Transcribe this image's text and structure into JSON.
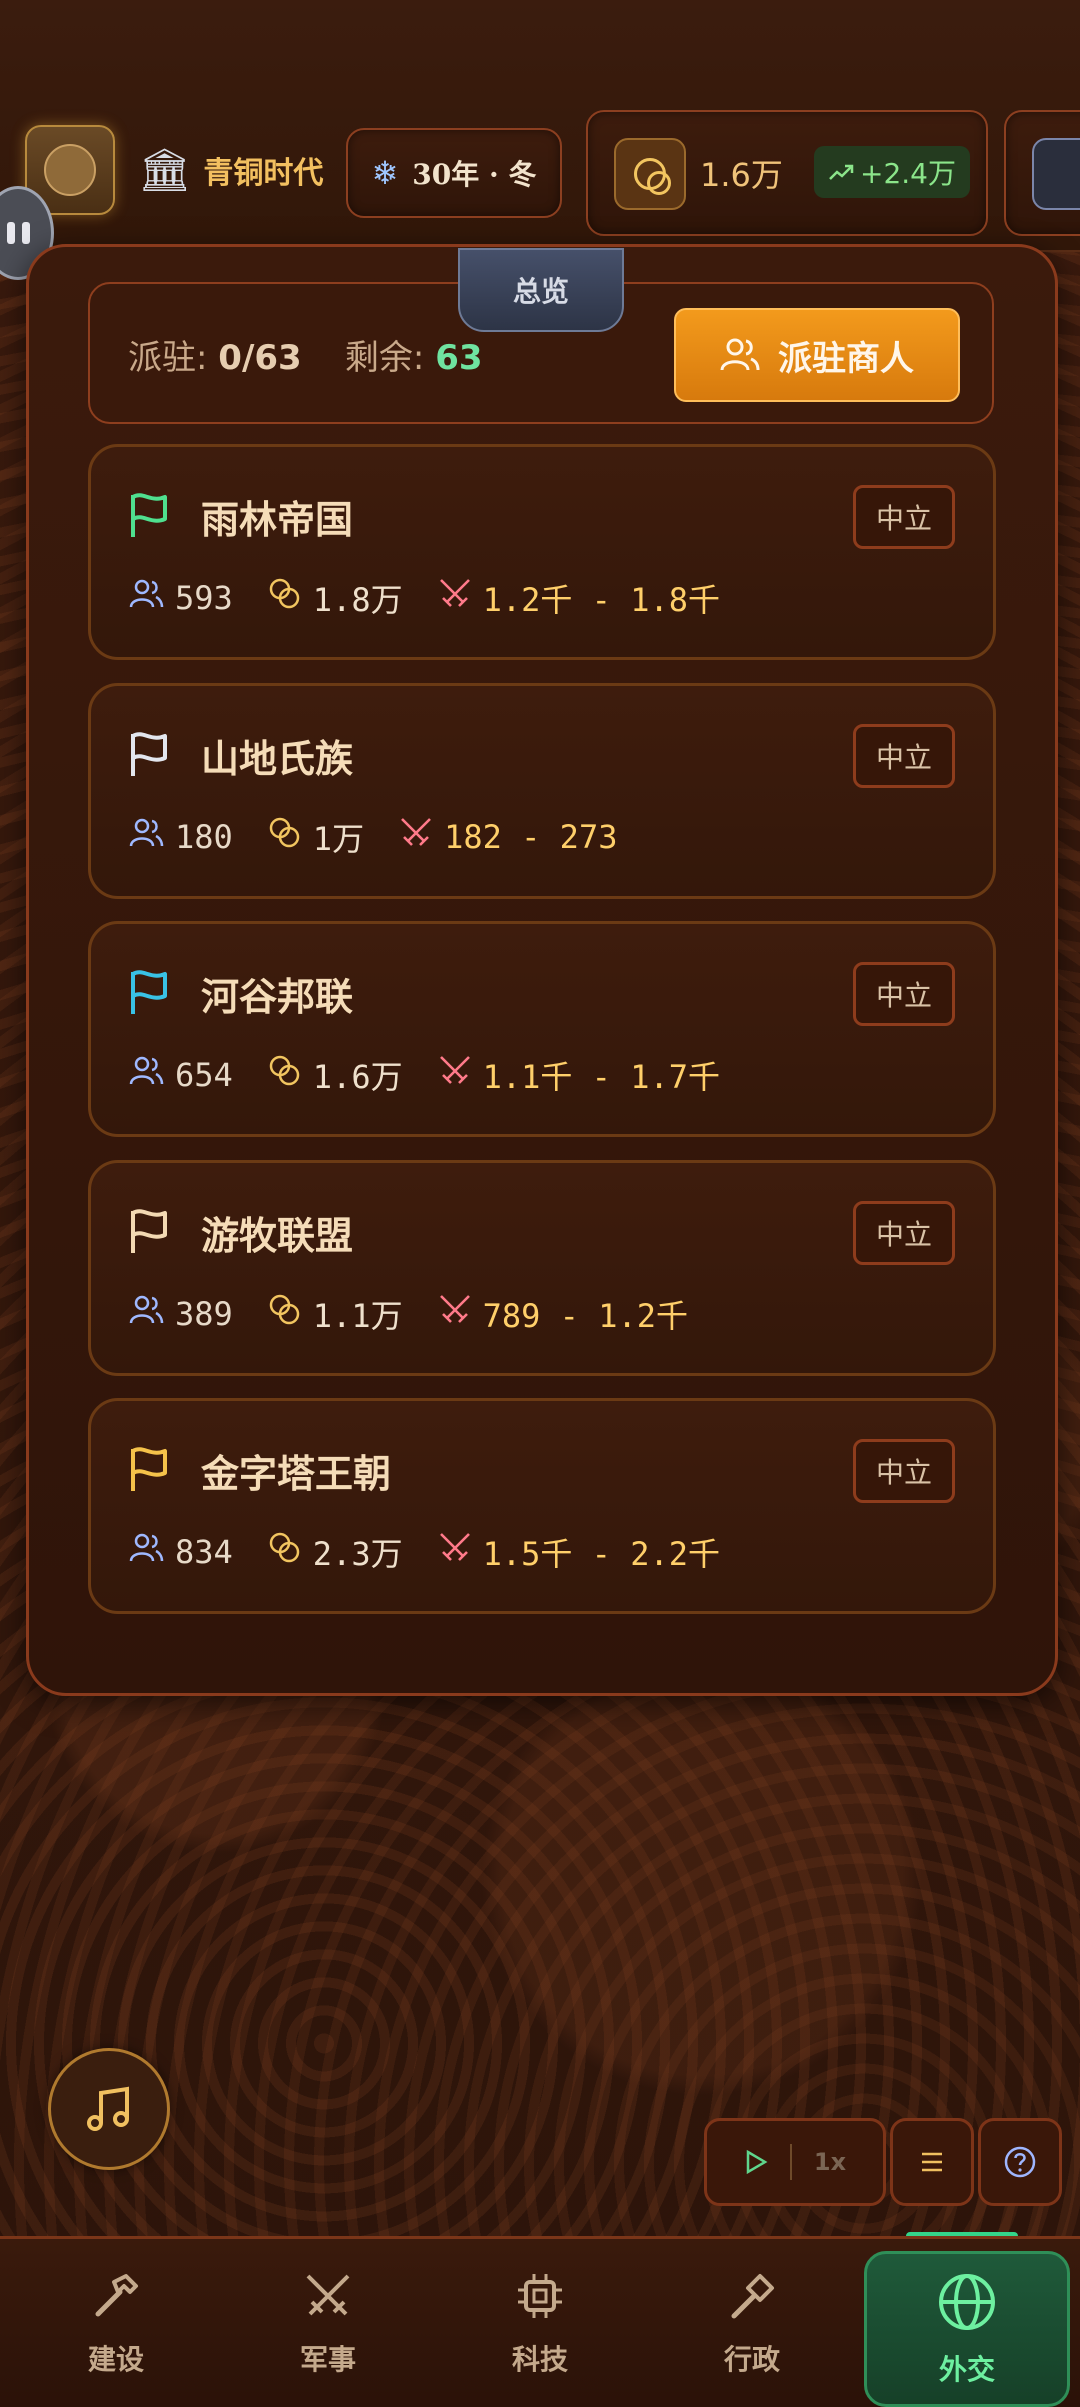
{
  "header": {
    "era_label": "青铜时代",
    "season_label": "30年 · 冬",
    "gold_value": "1.6万",
    "gold_delta": "+2.4万"
  },
  "overview_tab": {
    "label": "总览"
  },
  "summary": {
    "deployed_label": "派驻:",
    "deployed_value": "0/63",
    "remaining_label": "剩余:",
    "remaining_value": "63",
    "dispatch_button": "派驻商人"
  },
  "nations": [
    {
      "name": "雨林帝国",
      "status": "中立",
      "population": "593",
      "gold": "1.8万",
      "military": "1.2千 - 1.8千",
      "flag_color": "#4fe08f"
    },
    {
      "name": "山地氏族",
      "status": "中立",
      "population": "180",
      "gold": "1万",
      "military": "182 - 273",
      "flag_color": "#e3e6ee"
    },
    {
      "name": "河谷邦联",
      "status": "中立",
      "population": "654",
      "gold": "1.6万",
      "military": "1.1千 - 1.7千",
      "flag_color": "#39c2e6"
    },
    {
      "name": "游牧联盟",
      "status": "中立",
      "population": "389",
      "gold": "1.1万",
      "military": "789 - 1.2千",
      "flag_color": "#f3d9b3"
    },
    {
      "name": "金字塔王朝",
      "status": "中立",
      "population": "834",
      "gold": "2.3万",
      "military": "1.5千 - 2.2千",
      "flag_color": "#f5c24a"
    }
  ],
  "controls": {
    "speed_label": "1x"
  },
  "nav": {
    "items": [
      {
        "label": "建设",
        "icon": "hammer-icon"
      },
      {
        "label": "军事",
        "icon": "crossed-swords-icon"
      },
      {
        "label": "科技",
        "icon": "chip-icon"
      },
      {
        "label": "行政",
        "icon": "gavel-icon"
      },
      {
        "label": "外交",
        "icon": "globe-icon"
      }
    ],
    "active_index": 4
  },
  "colors": {
    "accent_orange": "#f39a1c",
    "active_green": "#33d58a",
    "panel_border": "#8a3a1c"
  }
}
